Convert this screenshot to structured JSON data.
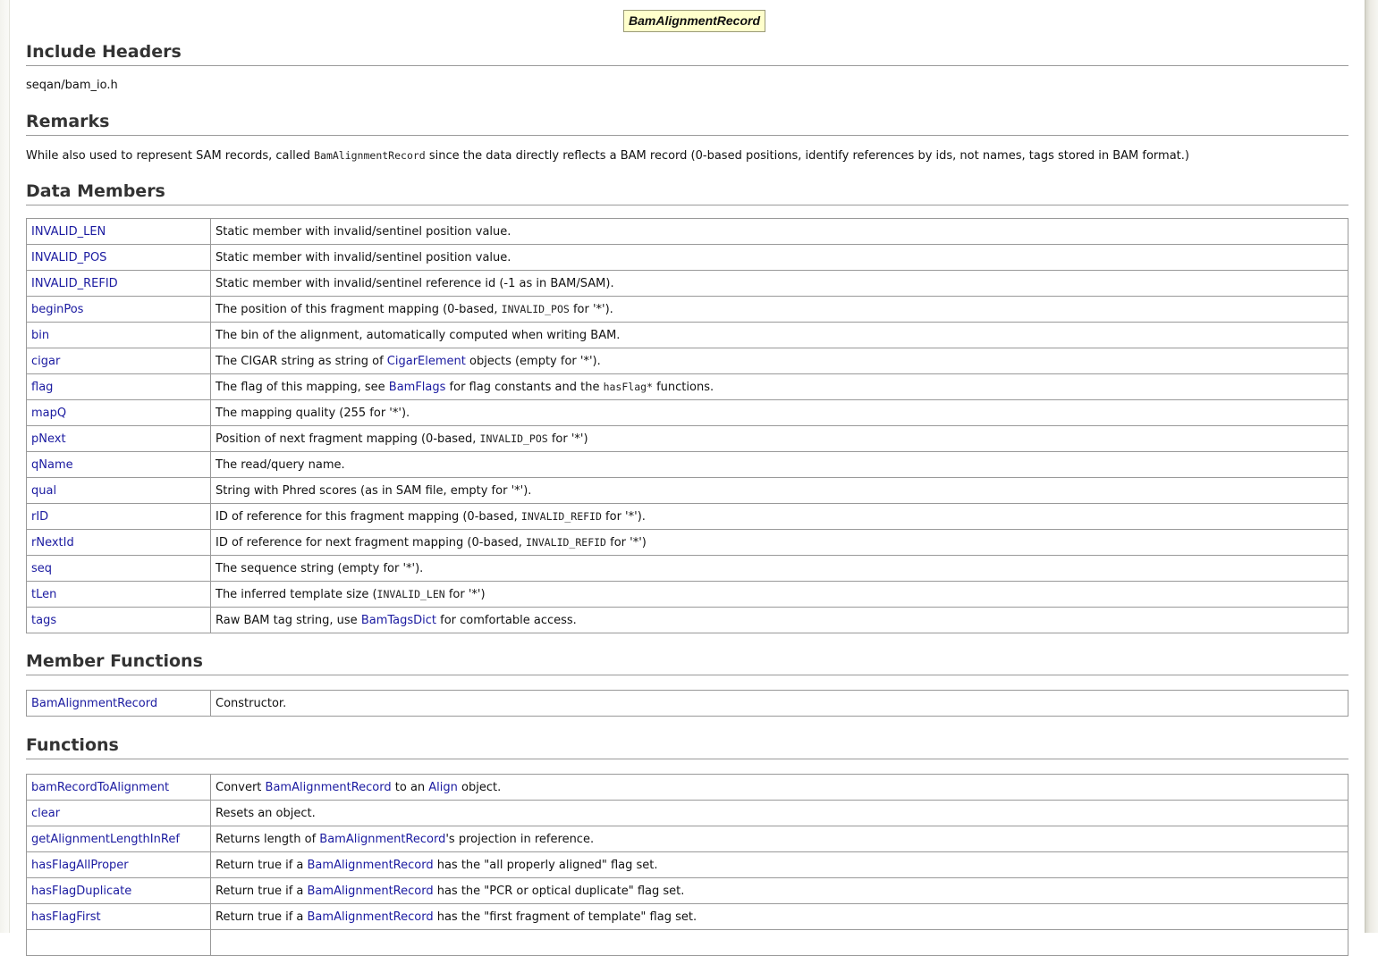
{
  "page_title": "BamAlignmentRecord",
  "include_headers": {
    "heading": "Include Headers",
    "value": "seqan/bam_io.h"
  },
  "remarks": {
    "heading": "Remarks",
    "text_before": "While also used to represent SAM records, called ",
    "code": "BamAlignmentRecord",
    "text_after": " since the data directly reflects a BAM record (0-based positions, identify references by ids, not names, tags stored in BAM format.)"
  },
  "data_members": {
    "heading": "Data Members",
    "rows": [
      {
        "name": "INVALID_LEN",
        "desc": [
          {
            "t": "Static member with invalid/sentinel position value."
          }
        ]
      },
      {
        "name": "INVALID_POS",
        "desc": [
          {
            "t": "Static member with invalid/sentinel position value."
          }
        ]
      },
      {
        "name": "INVALID_REFID",
        "desc": [
          {
            "t": "Static member with invalid/sentinel reference id (-1 as in BAM/SAM)."
          }
        ]
      },
      {
        "name": "beginPos",
        "desc": [
          {
            "t": "The position of this fragment mapping (0-based, "
          },
          {
            "c": "INVALID_POS"
          },
          {
            "t": " for '*')."
          }
        ]
      },
      {
        "name": "bin",
        "desc": [
          {
            "t": "The bin of the alignment, automatically computed when writing BAM."
          }
        ]
      },
      {
        "name": "cigar",
        "desc": [
          {
            "t": "The CIGAR string as string of "
          },
          {
            "l": "CigarElement"
          },
          {
            "t": " objects (empty for '*')."
          }
        ]
      },
      {
        "name": "flag",
        "desc": [
          {
            "t": "The flag of this mapping, see "
          },
          {
            "l": "BamFlags"
          },
          {
            "t": " for flag constants and the "
          },
          {
            "c": "hasFlag*"
          },
          {
            "t": " functions."
          }
        ]
      },
      {
        "name": "mapQ",
        "desc": [
          {
            "t": "The mapping quality (255 for '*')."
          }
        ]
      },
      {
        "name": "pNext",
        "desc": [
          {
            "t": "Position of next fragment mapping (0-based, "
          },
          {
            "c": "INVALID_POS"
          },
          {
            "t": " for '*')"
          }
        ]
      },
      {
        "name": "qName",
        "desc": [
          {
            "t": "The read/query name."
          }
        ]
      },
      {
        "name": "qual",
        "desc": [
          {
            "t": "String with Phred scores (as in SAM file, empty for '*')."
          }
        ]
      },
      {
        "name": "rID",
        "desc": [
          {
            "t": "ID of reference for this fragment mapping (0-based, "
          },
          {
            "c": "INVALID_REFID"
          },
          {
            "t": " for '*')."
          }
        ]
      },
      {
        "name": "rNextId",
        "desc": [
          {
            "t": "ID of reference for next fragment mapping (0-based, "
          },
          {
            "c": "INVALID_REFID"
          },
          {
            "t": " for '*')"
          }
        ]
      },
      {
        "name": "seq",
        "desc": [
          {
            "t": "The sequence string (empty for '*')."
          }
        ]
      },
      {
        "name": "tLen",
        "desc": [
          {
            "t": "The inferred template size ("
          },
          {
            "c": "INVALID_LEN"
          },
          {
            "t": " for '*')"
          }
        ]
      },
      {
        "name": "tags",
        "desc": [
          {
            "t": "Raw BAM tag string, use "
          },
          {
            "l": "BamTagsDict"
          },
          {
            "t": " for comfortable access."
          }
        ]
      }
    ]
  },
  "member_functions": {
    "heading": "Member Functions",
    "rows": [
      {
        "name": "BamAlignmentRecord",
        "desc": [
          {
            "t": "Constructor."
          }
        ]
      }
    ]
  },
  "functions": {
    "heading": "Functions",
    "rows": [
      {
        "name": "bamRecordToAlignment",
        "desc": [
          {
            "t": "Convert "
          },
          {
            "l": "BamAlignmentRecord"
          },
          {
            "t": " to an "
          },
          {
            "l": "Align"
          },
          {
            "t": " object."
          }
        ]
      },
      {
        "name": "clear",
        "desc": [
          {
            "t": "Resets an object."
          }
        ]
      },
      {
        "name": "getAlignmentLengthInRef",
        "desc": [
          {
            "t": "Returns length of "
          },
          {
            "l": "BamAlignmentRecord"
          },
          {
            "t": "'s projection in reference."
          }
        ]
      },
      {
        "name": "hasFlagAllProper",
        "desc": [
          {
            "t": "Return true if a "
          },
          {
            "l": "BamAlignmentRecord"
          },
          {
            "t": " has the \"all properly aligned\" flag set."
          }
        ]
      },
      {
        "name": "hasFlagDuplicate",
        "desc": [
          {
            "t": "Return true if a "
          },
          {
            "l": "BamAlignmentRecord"
          },
          {
            "t": " has the \"PCR or optical duplicate\" flag set."
          }
        ]
      },
      {
        "name": "hasFlagFirst",
        "desc": [
          {
            "t": "Return true if a "
          },
          {
            "l": "BamAlignmentRecord"
          },
          {
            "t": " has the \"first fragment of template\" flag set."
          }
        ]
      },
      {
        "name": "",
        "desc": [
          {
            "t": ""
          }
        ]
      }
    ]
  }
}
